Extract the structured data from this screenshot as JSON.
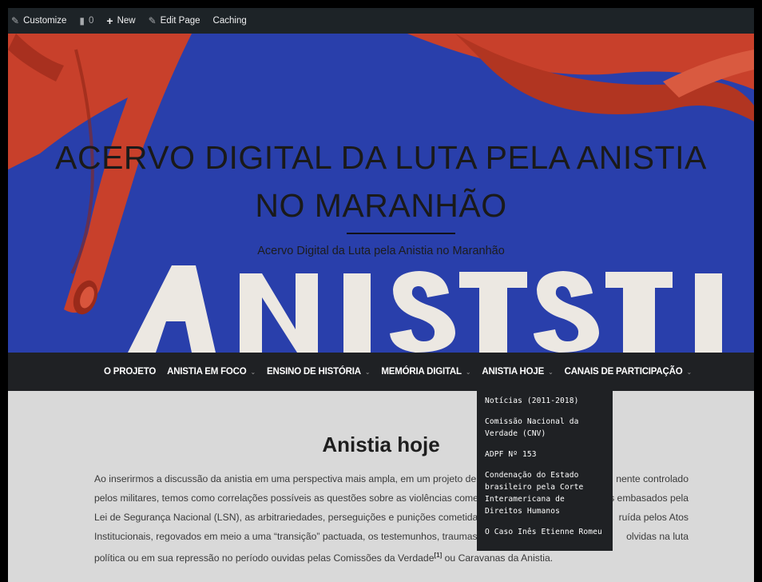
{
  "admin_bar": {
    "customize": "Customize",
    "comments_count": "0",
    "new": "New",
    "edit_page": "Edit Page",
    "caching": "Caching"
  },
  "hero": {
    "title_line1": "ACERVO DIGITAL DA LUTA PELA ANISTIA",
    "title_line2": "NO MARANHÃO",
    "tagline": "Acervo Digital da Luta pela Anistia no Maranhão",
    "poster_text": "ANIST"
  },
  "nav": {
    "items": [
      {
        "label": "O PROJETO"
      },
      {
        "label": "ANISTIA EM FOCO"
      },
      {
        "label": "ENSINO DE HISTÓRIA"
      },
      {
        "label": "MEMÓRIA DIGITAL"
      },
      {
        "label": "ANISTIA HOJE"
      },
      {
        "label": "CANAIS DE PARTICIPAÇÃO"
      }
    ],
    "chevron": "⌄"
  },
  "dropdown": {
    "items": [
      "Notícias (2011-2018)",
      "Comissão Nacional da Verdade (CNV)",
      "ADPF Nº 153",
      "Condenação do Estado brasileiro pela Corte Interamericana de Direitos Humanos",
      "O Caso Inês Etienne Romeu"
    ]
  },
  "content": {
    "title": "Anistia hoje",
    "lines": [
      "Ao inserirmos a discussão da anistia em uma perspectiva mais ampla, em um projeto de c",
      "pelos militares, temos como correlações possíveis as questões sobre as violências comet",
      "Lei de Segurança Nacional (LSN), as arbitrariedades, perseguições e punições cometidas",
      "Institucionais, regovados em meio a uma “transição” pactuada, os testemunhos, traumas",
      "política ou em sua repressão no período ouvidas pelas Comissões da Verdade"
    ],
    "right_fragments": [
      "nente controlado",
      "s embasados pela",
      "ruída pelos Atos",
      "olvidas na luta"
    ],
    "footnote": "[1]",
    "last_line_end": " ou Caravanas da Anistia."
  },
  "colors": {
    "admin_bar": "#1d2327",
    "hero_blue": "#2c44b5",
    "poster_red": "#c8402b",
    "nav_bg": "#1f2124",
    "content_bg": "#d9d9d9"
  }
}
